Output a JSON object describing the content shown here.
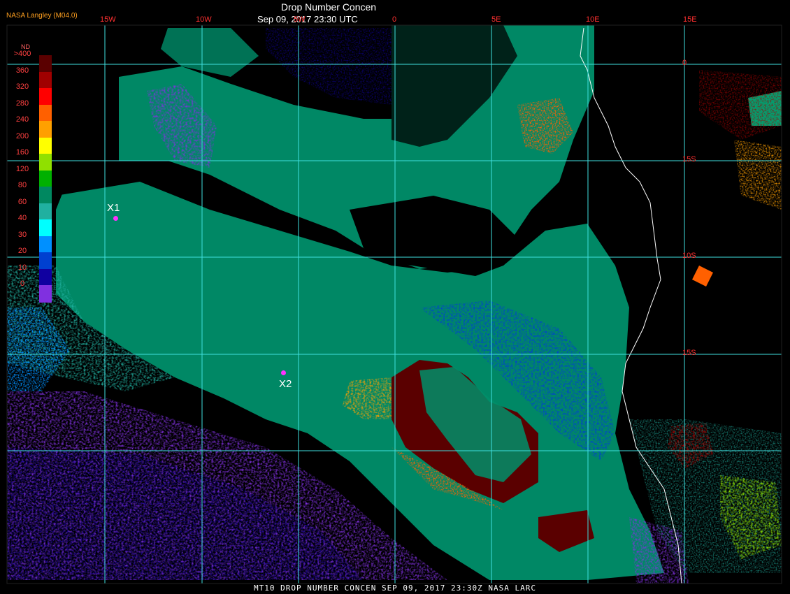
{
  "header": {
    "brand": "NASA Langley (M04.0)",
    "title": "Drop Number Concen",
    "datetime": "Sep 09, 2017 23:30 UTC"
  },
  "colorbar": {
    "title": "ND",
    "levels": [
      {
        "label": ">400",
        "color": "#5a0000"
      },
      {
        "label": "360",
        "color": "#a00000"
      },
      {
        "label": "320",
        "color": "#ff0000"
      },
      {
        "label": "280",
        "color": "#ff6000"
      },
      {
        "label": "240",
        "color": "#ffa000"
      },
      {
        "label": "200",
        "color": "#ffff00"
      },
      {
        "label": "160",
        "color": "#90e000"
      },
      {
        "label": "120",
        "color": "#00b000"
      },
      {
        "label": "80",
        "color": "#008860"
      },
      {
        "label": "60",
        "color": "#20b0a0"
      },
      {
        "label": "40",
        "color": "#00ffff"
      },
      {
        "label": "30",
        "color": "#0090ff"
      },
      {
        "label": "20",
        "color": "#0040d0"
      },
      {
        "label": "10",
        "color": "#1000a0"
      },
      {
        "label": "0",
        "color": "#8030e0"
      }
    ]
  },
  "longitude_labels": [
    "15W",
    "10W",
    "5W",
    "0",
    "5E",
    "10E",
    "15E"
  ],
  "latitude_labels": [
    "0",
    "15S",
    "10S",
    "15S"
  ],
  "markers": [
    {
      "label": "X1"
    },
    {
      "label": "X2"
    }
  ],
  "footer": "MT10  DROP NUMBER CONCEN   SEP 09, 2017 23:30Z   NASA LARC",
  "colors": {
    "background": "#000000",
    "grid": "#40e0e0",
    "coastline": "#ffffff",
    "marker": "#ff30ff",
    "labels": "#ff3030"
  }
}
